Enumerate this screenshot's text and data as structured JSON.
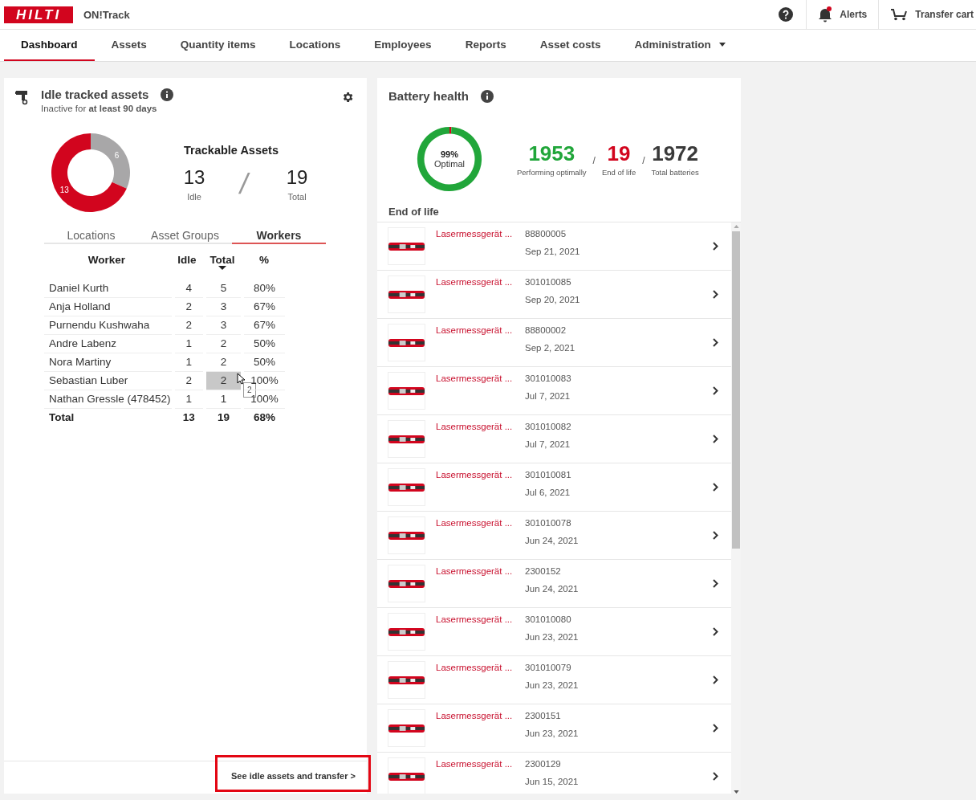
{
  "header": {
    "logo": "HILTI",
    "app_name": "ON!Track",
    "alerts": {
      "label": "Alerts",
      "unread": true
    },
    "cart": {
      "label": "Transfer cart"
    }
  },
  "nav": [
    {
      "label": "Dashboard",
      "selected": true,
      "has_menu": false
    },
    {
      "label": "Assets",
      "selected": false,
      "has_menu": false
    },
    {
      "label": "Quantity items",
      "selected": false,
      "has_menu": false
    },
    {
      "label": "Locations",
      "selected": false,
      "has_menu": false
    },
    {
      "label": "Employees",
      "selected": false,
      "has_menu": false
    },
    {
      "label": "Reports",
      "selected": false,
      "has_menu": false
    },
    {
      "label": "Asset costs",
      "selected": false,
      "has_menu": false
    },
    {
      "label": "Administration",
      "selected": false,
      "has_menu": true
    }
  ],
  "idle_card": {
    "title": "Idle tracked assets",
    "subtitle": "Inactive for **at least 90 days**",
    "chart_data": {
      "type": "donut",
      "values": [
        6,
        13
      ],
      "data_labels": true
    },
    "summary": {
      "title": "Trackable Assets",
      "idle": "13",
      "idle_label": "Idle",
      "separator": "/",
      "total": "19",
      "total_label": "Total"
    },
    "tabs": [
      {
        "label": "Locations",
        "selected": false
      },
      {
        "label": "Asset Groups",
        "selected": false
      },
      {
        "label": "Workers",
        "selected": true
      }
    ],
    "table": {
      "columns": [
        {
          "label": "Worker",
          "sorted": false
        },
        {
          "label": "Idle",
          "sorted": false
        },
        {
          "label": "Total",
          "sorted": true
        },
        {
          "label": "%",
          "sorted": false
        }
      ],
      "rows": [
        {
          "worker": "Daniel Kurth",
          "idle": "4",
          "total": "5",
          "percent": "80%",
          "total_hovered": false
        },
        {
          "worker": "Anja Holland",
          "idle": "2",
          "total": "3",
          "percent": "67%",
          "total_hovered": false
        },
        {
          "worker": "Purnendu Kushwaha",
          "idle": "2",
          "total": "3",
          "percent": "67%",
          "total_hovered": false
        },
        {
          "worker": "Andre Labenz",
          "idle": "1",
          "total": "2",
          "percent": "50%",
          "total_hovered": false
        },
        {
          "worker": "Nora Martiny",
          "idle": "1",
          "total": "2",
          "percent": "50%",
          "total_hovered": false
        },
        {
          "worker": "Sebastian Luber",
          "idle": "2",
          "total": "2",
          "percent": "100%",
          "total_hovered": true
        },
        {
          "worker": "Nathan Gressle (478452)",
          "idle": "1",
          "total": "1",
          "percent": "100%",
          "total_hovered": false
        }
      ],
      "total_row": {
        "worker": "Total",
        "idle": "13",
        "total": "19",
        "percent": "68%"
      },
      "tooltip": "2"
    },
    "footer_link": {
      "label": "See idle assets and transfer >",
      "highlighted": true
    }
  },
  "battery_card": {
    "title": "Battery health",
    "chart_data": {
      "type": "donut",
      "values": [
        99,
        1
      ]
    },
    "stat_separator": "/",
    "center_value": "99%",
    "center_label": "Optimal",
    "stats": [
      {
        "value": "1953",
        "label": "Performing optimally",
        "kind": "good"
      },
      {
        "value": "19",
        "label": "End of life",
        "kind": "bad"
      },
      {
        "value": "1972",
        "label": "Total batteries",
        "kind": "total"
      }
    ],
    "list_title": "End of life",
    "items": [
      {
        "name": "Lasermessgerät ...",
        "id": "88800005",
        "date": "Sep 21, 2021"
      },
      {
        "name": "Lasermessgerät ...",
        "id": "301010085",
        "date": "Sep 20, 2021"
      },
      {
        "name": "Lasermessgerät ...",
        "id": "88800002",
        "date": "Sep 2, 2021"
      },
      {
        "name": "Lasermessgerät ...",
        "id": "301010083",
        "date": "Jul 7, 2021"
      },
      {
        "name": "Lasermessgerät ...",
        "id": "301010082",
        "date": "Jul 7, 2021"
      },
      {
        "name": "Lasermessgerät ...",
        "id": "301010081",
        "date": "Jul 6, 2021"
      },
      {
        "name": "Lasermessgerät ...",
        "id": "301010078",
        "date": "Jun 24, 2021"
      },
      {
        "name": "Lasermessgerät ...",
        "id": "2300152",
        "date": "Jun 24, 2021"
      },
      {
        "name": "Lasermessgerät ...",
        "id": "301010080",
        "date": "Jun 23, 2021"
      },
      {
        "name": "Lasermessgerät ...",
        "id": "301010079",
        "date": "Jun 23, 2021"
      },
      {
        "name": "Lasermessgerät ...",
        "id": "2300151",
        "date": "Jun 23, 2021"
      },
      {
        "name": "Lasermessgerät ...",
        "id": "2300129",
        "date": "Jun 15, 2021"
      }
    ]
  }
}
